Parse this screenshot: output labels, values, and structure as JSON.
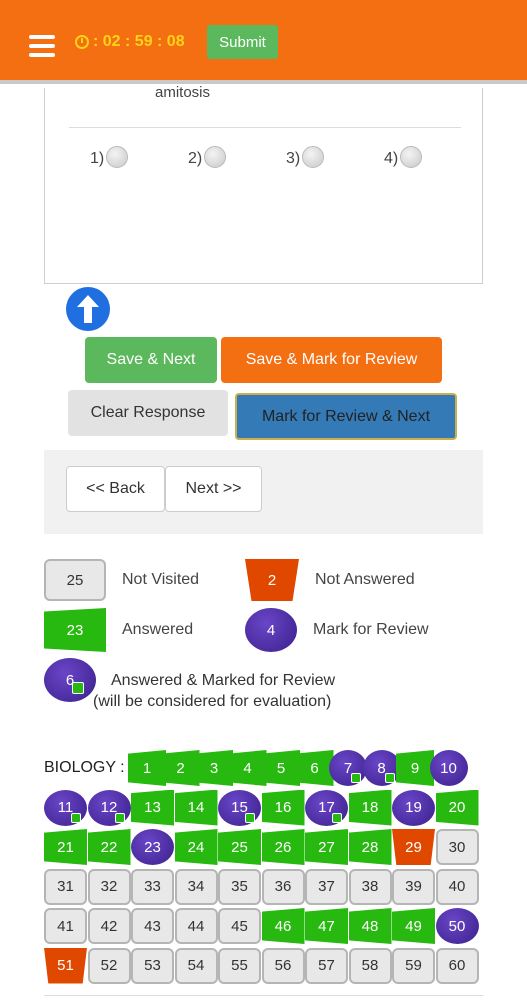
{
  "header": {
    "timer": ": 02 : 59 : 08",
    "submit_label": "Submit"
  },
  "question": {
    "text": "amitosis",
    "options": [
      "1)",
      "2)",
      "3)",
      "4)"
    ]
  },
  "actions": {
    "save_next": "Save & Next",
    "save_mark": "Save & Mark for Review",
    "clear": "Clear Response",
    "mark_next": "Mark for Review & Next"
  },
  "nav": {
    "back": "<< Back",
    "next": "Next >>"
  },
  "legend": {
    "not_visited": {
      "count": "25",
      "label": "Not Visited"
    },
    "not_answered": {
      "count": "2",
      "label": "Not Answered"
    },
    "answered": {
      "count": "23",
      "label": "Answered"
    },
    "marked": {
      "count": "4",
      "label": "Mark for Review"
    },
    "answered_marked": {
      "count": "6",
      "label": "Answered & Marked for Review",
      "note": "(will be considered for evaluation)"
    }
  },
  "palette": {
    "section": "BIOLOGY :",
    "questions": [
      {
        "n": "1",
        "s": "ans"
      },
      {
        "n": "2",
        "s": "ans"
      },
      {
        "n": "3",
        "s": "ans"
      },
      {
        "n": "4",
        "s": "ans"
      },
      {
        "n": "5",
        "s": "ans"
      },
      {
        "n": "6",
        "s": "ans"
      },
      {
        "n": "7",
        "s": "amr"
      },
      {
        "n": "8",
        "s": "amr"
      },
      {
        "n": "9",
        "s": "ans"
      },
      {
        "n": "10",
        "s": "mr"
      },
      {
        "n": "11",
        "s": "amr"
      },
      {
        "n": "12",
        "s": "amr"
      },
      {
        "n": "13",
        "s": "ans"
      },
      {
        "n": "14",
        "s": "ans"
      },
      {
        "n": "15",
        "s": "amr"
      },
      {
        "n": "16",
        "s": "ans"
      },
      {
        "n": "17",
        "s": "amr"
      },
      {
        "n": "18",
        "s": "ans"
      },
      {
        "n": "19",
        "s": "mr"
      },
      {
        "n": "20",
        "s": "ans"
      },
      {
        "n": "21",
        "s": "ans"
      },
      {
        "n": "22",
        "s": "ans"
      },
      {
        "n": "23",
        "s": "mr"
      },
      {
        "n": "24",
        "s": "ans"
      },
      {
        "n": "25",
        "s": "ans"
      },
      {
        "n": "26",
        "s": "ans"
      },
      {
        "n": "27",
        "s": "ans"
      },
      {
        "n": "28",
        "s": "ans"
      },
      {
        "n": "29",
        "s": "na"
      },
      {
        "n": "30",
        "s": "nv"
      },
      {
        "n": "31",
        "s": "nv"
      },
      {
        "n": "32",
        "s": "nv"
      },
      {
        "n": "33",
        "s": "nv"
      },
      {
        "n": "34",
        "s": "nv"
      },
      {
        "n": "35",
        "s": "nv"
      },
      {
        "n": "36",
        "s": "nv"
      },
      {
        "n": "37",
        "s": "nv"
      },
      {
        "n": "38",
        "s": "nv"
      },
      {
        "n": "39",
        "s": "nv"
      },
      {
        "n": "40",
        "s": "nv"
      },
      {
        "n": "41",
        "s": "nv"
      },
      {
        "n": "42",
        "s": "nv"
      },
      {
        "n": "43",
        "s": "nv"
      },
      {
        "n": "44",
        "s": "nv"
      },
      {
        "n": "45",
        "s": "nv"
      },
      {
        "n": "46",
        "s": "ans"
      },
      {
        "n": "47",
        "s": "ans"
      },
      {
        "n": "48",
        "s": "ans"
      },
      {
        "n": "49",
        "s": "ans"
      },
      {
        "n": "50",
        "s": "mr"
      },
      {
        "n": "51",
        "s": "na"
      },
      {
        "n": "52",
        "s": "nv"
      },
      {
        "n": "53",
        "s": "nv"
      },
      {
        "n": "54",
        "s": "nv"
      },
      {
        "n": "55",
        "s": "nv"
      },
      {
        "n": "56",
        "s": "nv"
      },
      {
        "n": "57",
        "s": "nv"
      },
      {
        "n": "58",
        "s": "nv"
      },
      {
        "n": "59",
        "s": "nv"
      },
      {
        "n": "60",
        "s": "nv"
      }
    ]
  },
  "colors": {
    "brand": "#f36f12",
    "answered": "#27b90f",
    "not_answered": "#e04800",
    "marked": "#4a2ea8",
    "timer": "#ffd21a"
  }
}
